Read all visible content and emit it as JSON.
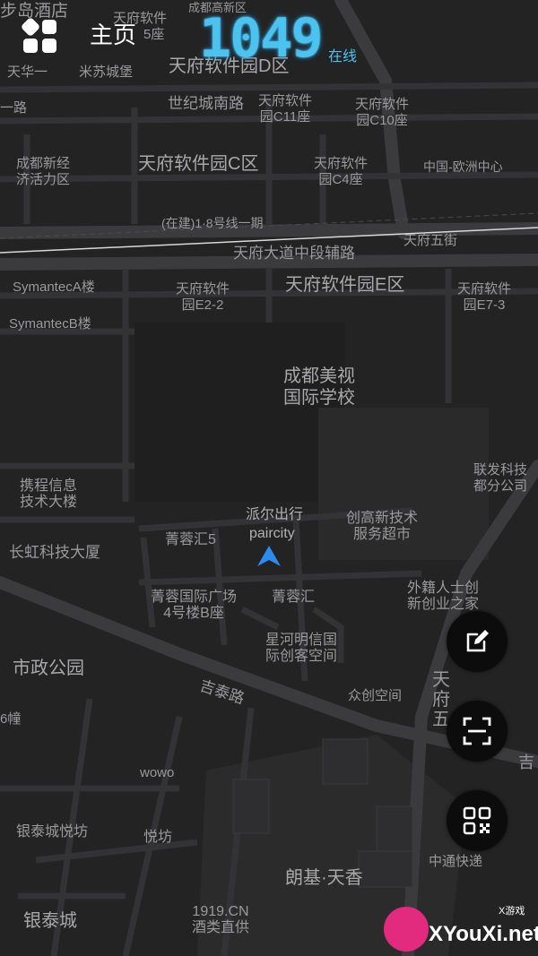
{
  "header": {
    "title": "主页",
    "online_count": "1049",
    "online_label": "在线"
  },
  "map": {
    "location_marker_label_cn": "派尔出行",
    "location_marker_label_en": "paircity",
    "labels": {
      "l1": "步岛酒店",
      "l2": "成都高新区",
      "l3": "天府软件",
      "l3b": "5座",
      "l4": "天府软件园D区",
      "l5": "米苏城堡",
      "l6": "世纪城南路",
      "l7": "天府软件\n园C11座",
      "l8": "天府软件\n园C10座",
      "l9": "成都新经\n济活力区",
      "l10": "天府软件园C区",
      "l11": "天府软件\n园C4座",
      "l12": "中国-欧洲中心",
      "l13": "(在建)1·8号线一期",
      "l14": "天府大道中段辅路",
      "l15": "天府五街",
      "l16": "SymantecA楼",
      "l17": "天府软件\n园E2-2",
      "l18": "天府软件园E区",
      "l19": "天府软件\n园E7-3",
      "l20": "SymantecB楼",
      "l21": "成都美视\n国际学校",
      "l22": "联发科技\n都分公司",
      "l23": "携程信息\n技术大楼",
      "l24": "创高新技术\n服务超市",
      "l25": "菁蓉汇5",
      "l26": "长虹科技大厦",
      "l27": "外籍人士创\n新创业之家",
      "l28": "菁蓉国际广场\n4号楼B座",
      "l29": "菁蓉汇",
      "l30": "星河明信国\n际创客空间",
      "l31": "市政公园",
      "l32": "吉泰路",
      "l33": "众创空间",
      "l34": "天府五",
      "l35": "6幢",
      "l36": "吉",
      "l37": "wowo",
      "l38": "银泰城悦坊",
      "l39": "悦坊",
      "l40": "朗基·天香",
      "l41": "中通快递",
      "l42": "银泰城",
      "l43": "1919.CN\n酒类直供",
      "l44": "天华一",
      "l45": "一路"
    }
  },
  "watermark": {
    "text": "XYouXi.net",
    "small": "X游戏"
  },
  "icons": {
    "menu": "grid-menu-icon",
    "edit": "edit-icon",
    "scan": "scan-icon",
    "qr": "qr-code-icon",
    "location": "navigation-arrow-icon"
  },
  "colors": {
    "accent": "#4cc3ee",
    "map_bg": "#232324",
    "road": "#3a3a3c",
    "fab_bg": "#0c0c0d"
  }
}
